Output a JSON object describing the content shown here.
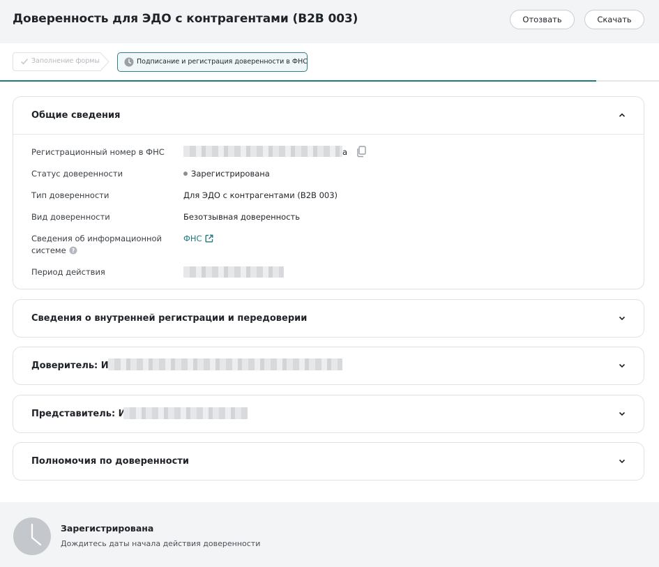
{
  "header": {
    "title": "Доверенность для ЭДО с контрагентами (B2B 003)",
    "revoke_label": "Отозвать",
    "download_label": "Скачать"
  },
  "steps": [
    {
      "label": "Заполнение формы",
      "state": "completed",
      "icon": "check-icon"
    },
    {
      "label": "Подписание и регистрация доверенности в ФНС",
      "state": "current",
      "icon": "clock-icon"
    }
  ],
  "progress": {
    "value": 0.905
  },
  "general": {
    "title": "Общие сведения",
    "expanded": true,
    "rows": {
      "reg_number": {
        "label": "Регистрационный номер в ФНС",
        "tail": "a"
      },
      "status": {
        "label": "Статус доверенности",
        "value": "Зарегистрирована"
      },
      "type": {
        "label": "Тип доверенности",
        "value": "Для ЭДО с контрагентами (B2B 003)"
      },
      "kind": {
        "label": "Вид доверенности",
        "value": "Безотзывная доверенность"
      },
      "info_system": {
        "label": "Сведения об информационной системе",
        "value": "ФНС"
      },
      "period": {
        "label": "Период действия"
      }
    }
  },
  "sections": {
    "internal": {
      "title": "Сведения о внутренней регистрации и передоверии"
    },
    "principal": {
      "title": "Доверитель: ИП"
    },
    "representative": {
      "title": "Представитель: ИП"
    },
    "powers": {
      "title": "Полномочия по доверенности"
    }
  },
  "footer": {
    "title": "Зарегистрирована",
    "subtitle": "Дождитесь даты начала действия доверенности"
  },
  "colors": {
    "accent": "#1f7a80",
    "status_dot": "#8a8f96",
    "header_bg": "#f3f4f6"
  }
}
